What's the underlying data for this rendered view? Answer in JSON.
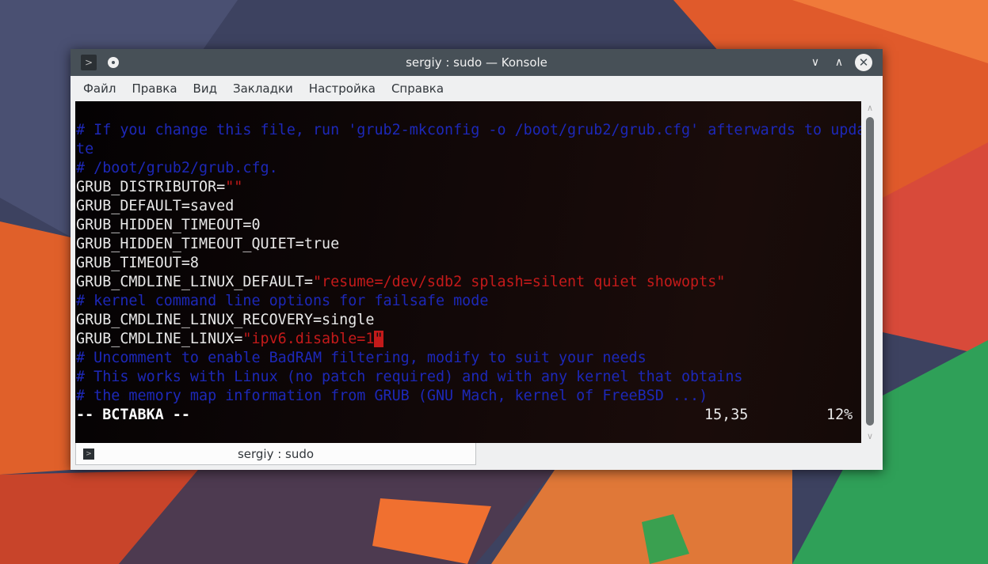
{
  "window": {
    "title": "sergiy : sudo — Konsole"
  },
  "menu": [
    "Файл",
    "Правка",
    "Вид",
    "Закладки",
    "Настройка",
    "Справка"
  ],
  "terminal": {
    "lines": [
      [
        {
          "t": "# If you change this file, run 'grub2-mkconfig -o /boot/grub2/grub.cfg' afterwards to upda",
          "c": "cm"
        }
      ],
      [
        {
          "t": "te",
          "c": "cm"
        }
      ],
      [
        {
          "t": "# /boot/grub2/grub.cfg.",
          "c": "cm"
        }
      ],
      [
        {
          "t": "GRUB_DISTRIBUTOR=",
          "c": ""
        },
        {
          "t": "\"\"",
          "c": "st"
        }
      ],
      [
        {
          "t": "GRUB_DEFAULT=saved",
          "c": ""
        }
      ],
      [
        {
          "t": "GRUB_HIDDEN_TIMEOUT=0",
          "c": ""
        }
      ],
      [
        {
          "t": "GRUB_HIDDEN_TIMEOUT_QUIET=true",
          "c": ""
        }
      ],
      [
        {
          "t": "GRUB_TIMEOUT=8",
          "c": ""
        }
      ],
      [
        {
          "t": "GRUB_CMDLINE_LINUX_DEFAULT=",
          "c": ""
        },
        {
          "t": "\"resume=/dev/sdb2 splash=silent quiet showopts\"",
          "c": "st"
        }
      ],
      [
        {
          "t": "# kernel command line options for failsafe mode",
          "c": "cm"
        }
      ],
      [
        {
          "t": "GRUB_CMDLINE_LINUX_RECOVERY=single",
          "c": ""
        }
      ],
      [
        {
          "t": "GRUB_CMDLINE_LINUX=",
          "c": ""
        },
        {
          "t": "\"ipv6.disable=1",
          "c": "st"
        },
        {
          "t": "\"",
          "c": "cur"
        }
      ],
      [
        {
          "t": "# Uncomment to enable BadRAM filtering, modify to suit your needs",
          "c": "cm"
        }
      ],
      [
        {
          "t": "# This works with Linux (no patch required) and with any kernel that obtains",
          "c": "cm"
        }
      ],
      [
        {
          "t": "# the memory map information from GRUB (GNU Mach, kernel of FreeBSD ...)",
          "c": "cm"
        }
      ]
    ],
    "status": {
      "mode": "-- ВСТАВКА --",
      "position": "15,35",
      "percent": "12%"
    }
  },
  "tab": {
    "label": "sergiy : sudo"
  }
}
